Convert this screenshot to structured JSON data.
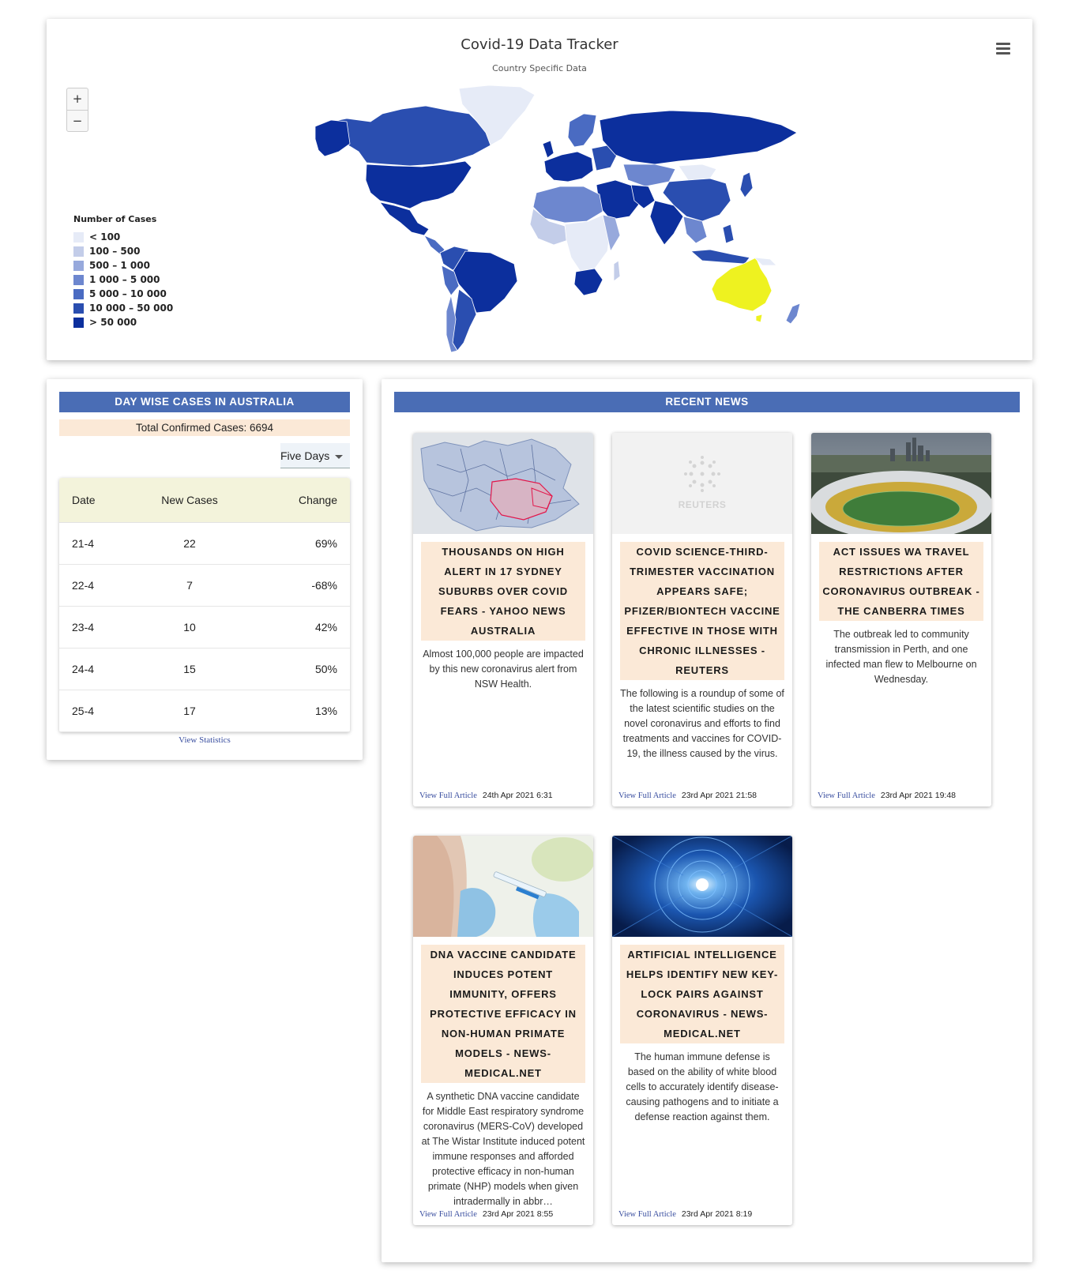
{
  "map": {
    "title": "Covid-19 Data Tracker",
    "subtitle": "Country Specific Data",
    "menu_icon": "hamburger-icon",
    "zoom_in": "+",
    "zoom_out": "−",
    "highlight_country": "Australia",
    "highlight_color": "#eef220",
    "legend": {
      "title": "Number of Cases",
      "items": [
        {
          "label": "< 100",
          "color": "#e6ebf7"
        },
        {
          "label": "100 – 500",
          "color": "#c3cde9"
        },
        {
          "label": "500 – 1 000",
          "color": "#97a9dc"
        },
        {
          "label": "1 000 – 5 000",
          "color": "#6d87cf"
        },
        {
          "label": "5 000 – 10 000",
          "color": "#4a6bc2"
        },
        {
          "label": "10 000 – 50 000",
          "color": "#2a4eb0"
        },
        {
          "label": "> 50 000",
          "color": "#0c2f9d"
        }
      ]
    }
  },
  "daywise": {
    "header": "DAY WISE CASES IN AUSTRALIA",
    "total": "Total Confirmed Cases: 6694",
    "period": "Five Days",
    "columns": [
      "Date",
      "New Cases",
      "Change"
    ],
    "rows": [
      [
        "21-4",
        "22",
        "69%"
      ],
      [
        "22-4",
        "7",
        "-68%"
      ],
      [
        "23-4",
        "10",
        "42%"
      ],
      [
        "24-4",
        "15",
        "50%"
      ],
      [
        "25-4",
        "17",
        "13%"
      ]
    ],
    "view_stats": "View Statistics"
  },
  "news": {
    "header": "RECENT NEWS",
    "link_label": "View Full Article",
    "items": [
      {
        "title": "THOUSANDS ON HIGH ALERT IN 17 SYDNEY SUBURBS OVER COVID FEARS - YAHOO NEWS AUSTRALIA",
        "desc": "Almost 100,000 people are impacted by this new coronavirus alert from NSW Health.",
        "date": "24th Apr 2021 6:31",
        "image": "sydney-suburbs-map"
      },
      {
        "title": "COVID SCIENCE-THIRD-TRIMESTER VACCINATION APPEARS SAFE; PFIZER/BIONTECH VACCINE EFFECTIVE IN THOSE WITH CHRONIC ILLNESSES - REUTERS",
        "desc": "The following is a roundup of some of the latest scientific studies on the novel coronavirus and efforts to find treatments and vaccines for COVID-19, the illness caused by the virus.",
        "date": "23rd Apr 2021 21:58",
        "image": "reuters-logo",
        "logo_text": "REUTERS"
      },
      {
        "title": "ACT ISSUES WA TRAVEL RESTRICTIONS AFTER CORONAVIRUS OUTBREAK - THE CANBERRA TIMES",
        "desc": "The outbreak led to community transmission in Perth, and one infected man flew to Melbourne on Wednesday.",
        "date": "23rd Apr 2021 19:48",
        "image": "perth-stadium"
      },
      {
        "title": "DNA VACCINE CANDIDATE INDUCES POTENT IMMUNITY, OFFERS PROTECTIVE EFFICACY IN NON-HUMAN PRIMATE MODELS - NEWS-MEDICAL.NET",
        "desc": "A synthetic DNA vaccine candidate for Middle East respiratory syndrome coronavirus (MERS-CoV) developed at The Wistar Institute induced potent immune responses and afforded protective efficacy in non-human primate (NHP) models when given intradermally in abbr…",
        "date": "23rd Apr 2021 8:55",
        "image": "vaccine-injection"
      },
      {
        "title": "ARTIFICIAL INTELLIGENCE HELPS IDENTIFY NEW KEY-LOCK PAIRS AGAINST CORONAVIRUS - NEWS-MEDICAL.NET",
        "desc": "The human immune defense is based on the ability of white blood cells to accurately identify disease-causing pathogens and to initiate a defense reaction against them.",
        "date": "23rd Apr 2021 8:19",
        "image": "ai-tunnel"
      }
    ]
  }
}
